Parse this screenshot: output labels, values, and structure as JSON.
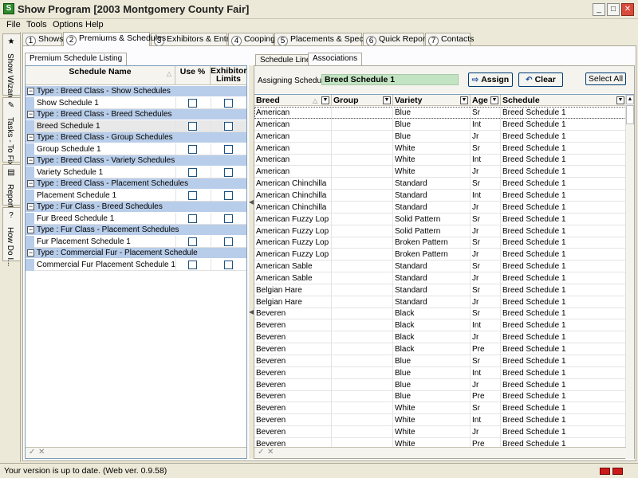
{
  "window": {
    "title": "Show Program [2003 Montgomery County Fair]",
    "app_icon": "app-logo-icon"
  },
  "menu": [
    "File",
    "Tools",
    "Options",
    "Help"
  ],
  "side_tabs": [
    {
      "label": "Show Wizard",
      "icon": "wizard-icon"
    },
    {
      "label": "Tasks - To Fix",
      "icon": "tasks-icon"
    },
    {
      "label": "Reports",
      "icon": "reports-icon"
    },
    {
      "label": "How Do I...",
      "icon": "help-icon"
    }
  ],
  "main_tabs": [
    {
      "num": "1",
      "label": "Shows"
    },
    {
      "num": "2",
      "label": "Premiums & Schedules"
    },
    {
      "num": "3",
      "label": "Exhibitors & Entries"
    },
    {
      "num": "4",
      "label": "Cooping"
    },
    {
      "num": "5",
      "label": "Placements & Specials"
    },
    {
      "num": "6",
      "label": "Quick Reports"
    },
    {
      "num": "7",
      "label": "Contacts"
    }
  ],
  "left": {
    "tab": "Premium Schedule Listing",
    "headers": {
      "name": "Schedule Name",
      "use_pct": "Use %",
      "limits": "Exhibitor Limits"
    },
    "groups": [
      {
        "type": "Type : Breed Class - Show Schedules",
        "item": "Show Schedule 1"
      },
      {
        "type": "Type : Breed Class - Breed Schedules",
        "item": "Breed Schedule 1"
      },
      {
        "type": "Type : Breed Class - Group Schedules",
        "item": "Group Schedule 1"
      },
      {
        "type": "Type : Breed Class - Variety Schedules",
        "item": "Variety Schedule 1"
      },
      {
        "type": "Type : Breed Class - Placement Schedules",
        "item": "Placement Schedule 1"
      },
      {
        "type": "Type : Fur Class - Breed Schedules",
        "item": "Fur Breed Schedule 1"
      },
      {
        "type": "Type : Fur Class - Placement Schedules",
        "item": "Fur Placement Schedule 1"
      },
      {
        "type": "Type : Commercial Fur - Placement Schedule",
        "item": "Commercial Fur Placement Schedule 1"
      }
    ]
  },
  "right": {
    "tabs": [
      "Schedule Lines",
      "Associations"
    ],
    "assign_label": "Assigning Schedule:",
    "assign_value": "Breed Schedule 1",
    "assign_button": "Assign",
    "clear_button": "Clear",
    "select_all_button": "Select All",
    "columns": [
      "Breed",
      "Group",
      "Variety",
      "Age",
      "Schedule"
    ],
    "rows": [
      [
        "American",
        "",
        "Blue",
        "Sr",
        "Breed Schedule 1"
      ],
      [
        "American",
        "",
        "Blue",
        "Int",
        "Breed Schedule 1"
      ],
      [
        "American",
        "",
        "Blue",
        "Jr",
        "Breed Schedule 1"
      ],
      [
        "American",
        "",
        "White",
        "Sr",
        "Breed Schedule 1"
      ],
      [
        "American",
        "",
        "White",
        "Int",
        "Breed Schedule 1"
      ],
      [
        "American",
        "",
        "White",
        "Jr",
        "Breed Schedule 1"
      ],
      [
        "American Chinchilla",
        "",
        "Standard",
        "Sr",
        "Breed Schedule 1"
      ],
      [
        "American Chinchilla",
        "",
        "Standard",
        "Int",
        "Breed Schedule 1"
      ],
      [
        "American Chinchilla",
        "",
        "Standard",
        "Jr",
        "Breed Schedule 1"
      ],
      [
        "American Fuzzy Lop",
        "",
        "Solid Pattern",
        "Sr",
        "Breed Schedule 1"
      ],
      [
        "American Fuzzy Lop",
        "",
        "Solid Pattern",
        "Jr",
        "Breed Schedule 1"
      ],
      [
        "American Fuzzy Lop",
        "",
        "Broken Pattern",
        "Sr",
        "Breed Schedule 1"
      ],
      [
        "American Fuzzy Lop",
        "",
        "Broken Pattern",
        "Jr",
        "Breed Schedule 1"
      ],
      [
        "American Sable",
        "",
        "Standard",
        "Sr",
        "Breed Schedule 1"
      ],
      [
        "American Sable",
        "",
        "Standard",
        "Jr",
        "Breed Schedule 1"
      ],
      [
        "Belgian Hare",
        "",
        "Standard",
        "Sr",
        "Breed Schedule 1"
      ],
      [
        "Belgian Hare",
        "",
        "Standard",
        "Jr",
        "Breed Schedule 1"
      ],
      [
        "Beveren",
        "",
        "Black",
        "Sr",
        "Breed Schedule 1"
      ],
      [
        "Beveren",
        "",
        "Black",
        "Int",
        "Breed Schedule 1"
      ],
      [
        "Beveren",
        "",
        "Black",
        "Jr",
        "Breed Schedule 1"
      ],
      [
        "Beveren",
        "",
        "Black",
        "Pre",
        "Breed Schedule 1"
      ],
      [
        "Beveren",
        "",
        "Blue",
        "Sr",
        "Breed Schedule 1"
      ],
      [
        "Beveren",
        "",
        "Blue",
        "Int",
        "Breed Schedule 1"
      ],
      [
        "Beveren",
        "",
        "Blue",
        "Jr",
        "Breed Schedule 1"
      ],
      [
        "Beveren",
        "",
        "Blue",
        "Pre",
        "Breed Schedule 1"
      ],
      [
        "Beveren",
        "",
        "White",
        "Sr",
        "Breed Schedule 1"
      ],
      [
        "Beveren",
        "",
        "White",
        "Int",
        "Breed Schedule 1"
      ],
      [
        "Beveren",
        "",
        "White",
        "Jr",
        "Breed Schedule 1"
      ],
      [
        "Beveren",
        "",
        "White",
        "Pre",
        "Breed Schedule 1"
      ]
    ]
  },
  "status": "Your version is up to date. (Web ver. 0.9.58)",
  "colors": {
    "group_row": "#b8cde9",
    "assign_field": "#c2e4c2",
    "status_flag": "#cc1a1a"
  }
}
